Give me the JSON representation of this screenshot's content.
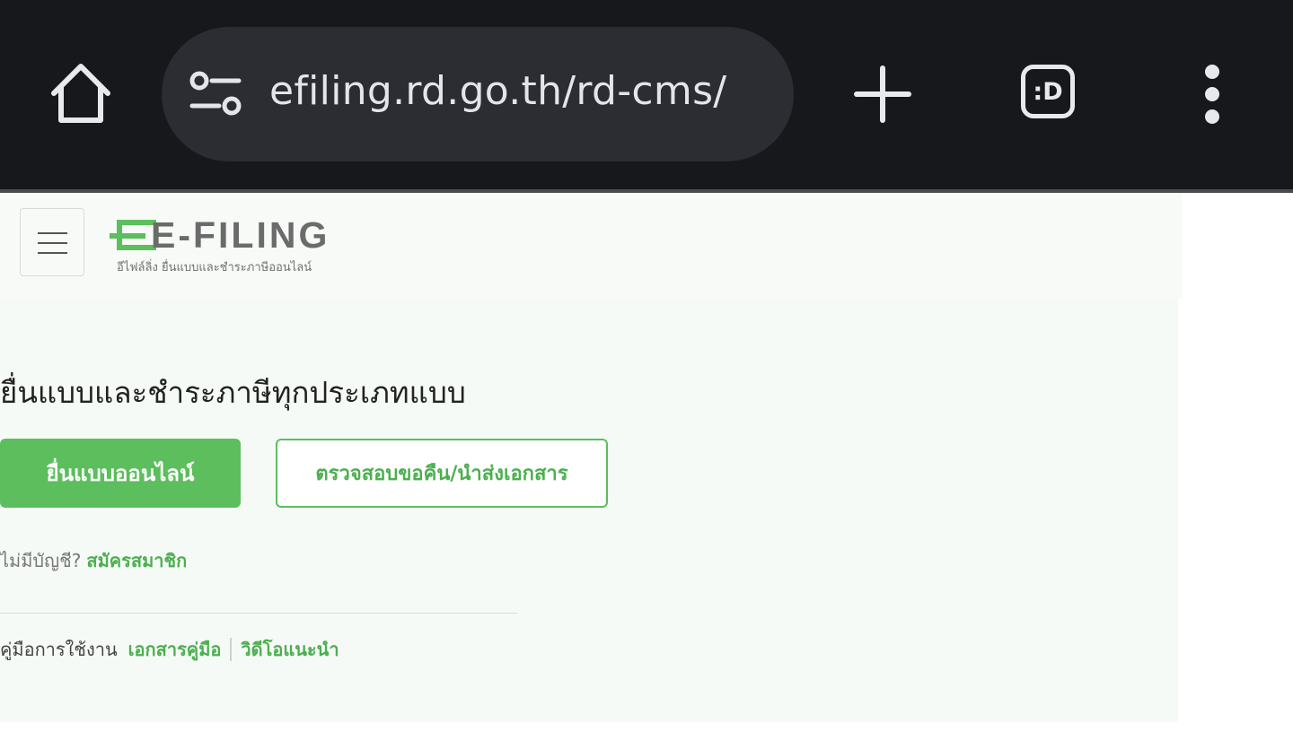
{
  "browser": {
    "url": "efiling.rd.go.th/rd-cms/",
    "tab_switcher_label": ":D",
    "icons": [
      "home-icon",
      "site-settings-icon",
      "plus-icon",
      "tab-switcher-icon",
      "more-vert-icon"
    ]
  },
  "header": {
    "logo_main": "E-FILING",
    "logo_sub": "อีไฟล์ลิ่ง ยื่นแบบและชำระภาษีออนไลน์",
    "logo_color": "#5cbe5c"
  },
  "main": {
    "headline": "ยื่นแบบและชำระภาษีทุกประเภทแบบ",
    "primary_button": "ยื่นแบบออนไลน์",
    "secondary_button": "ตรวจสอบขอคืน/นำส่งเอกสาร",
    "signup_prompt": "ไม่มีบัญชี?",
    "signup_link": "สมัครสมาชิก",
    "manual_label": "คู่มือการใช้งาน",
    "manual_links": [
      "เอกสารคู่มือ",
      "วิดีโอแนะนำ"
    ]
  },
  "colors": {
    "accent": "#5cbe5c",
    "chrome_bg": "#17181c",
    "page_bg": "#f6faf6"
  }
}
